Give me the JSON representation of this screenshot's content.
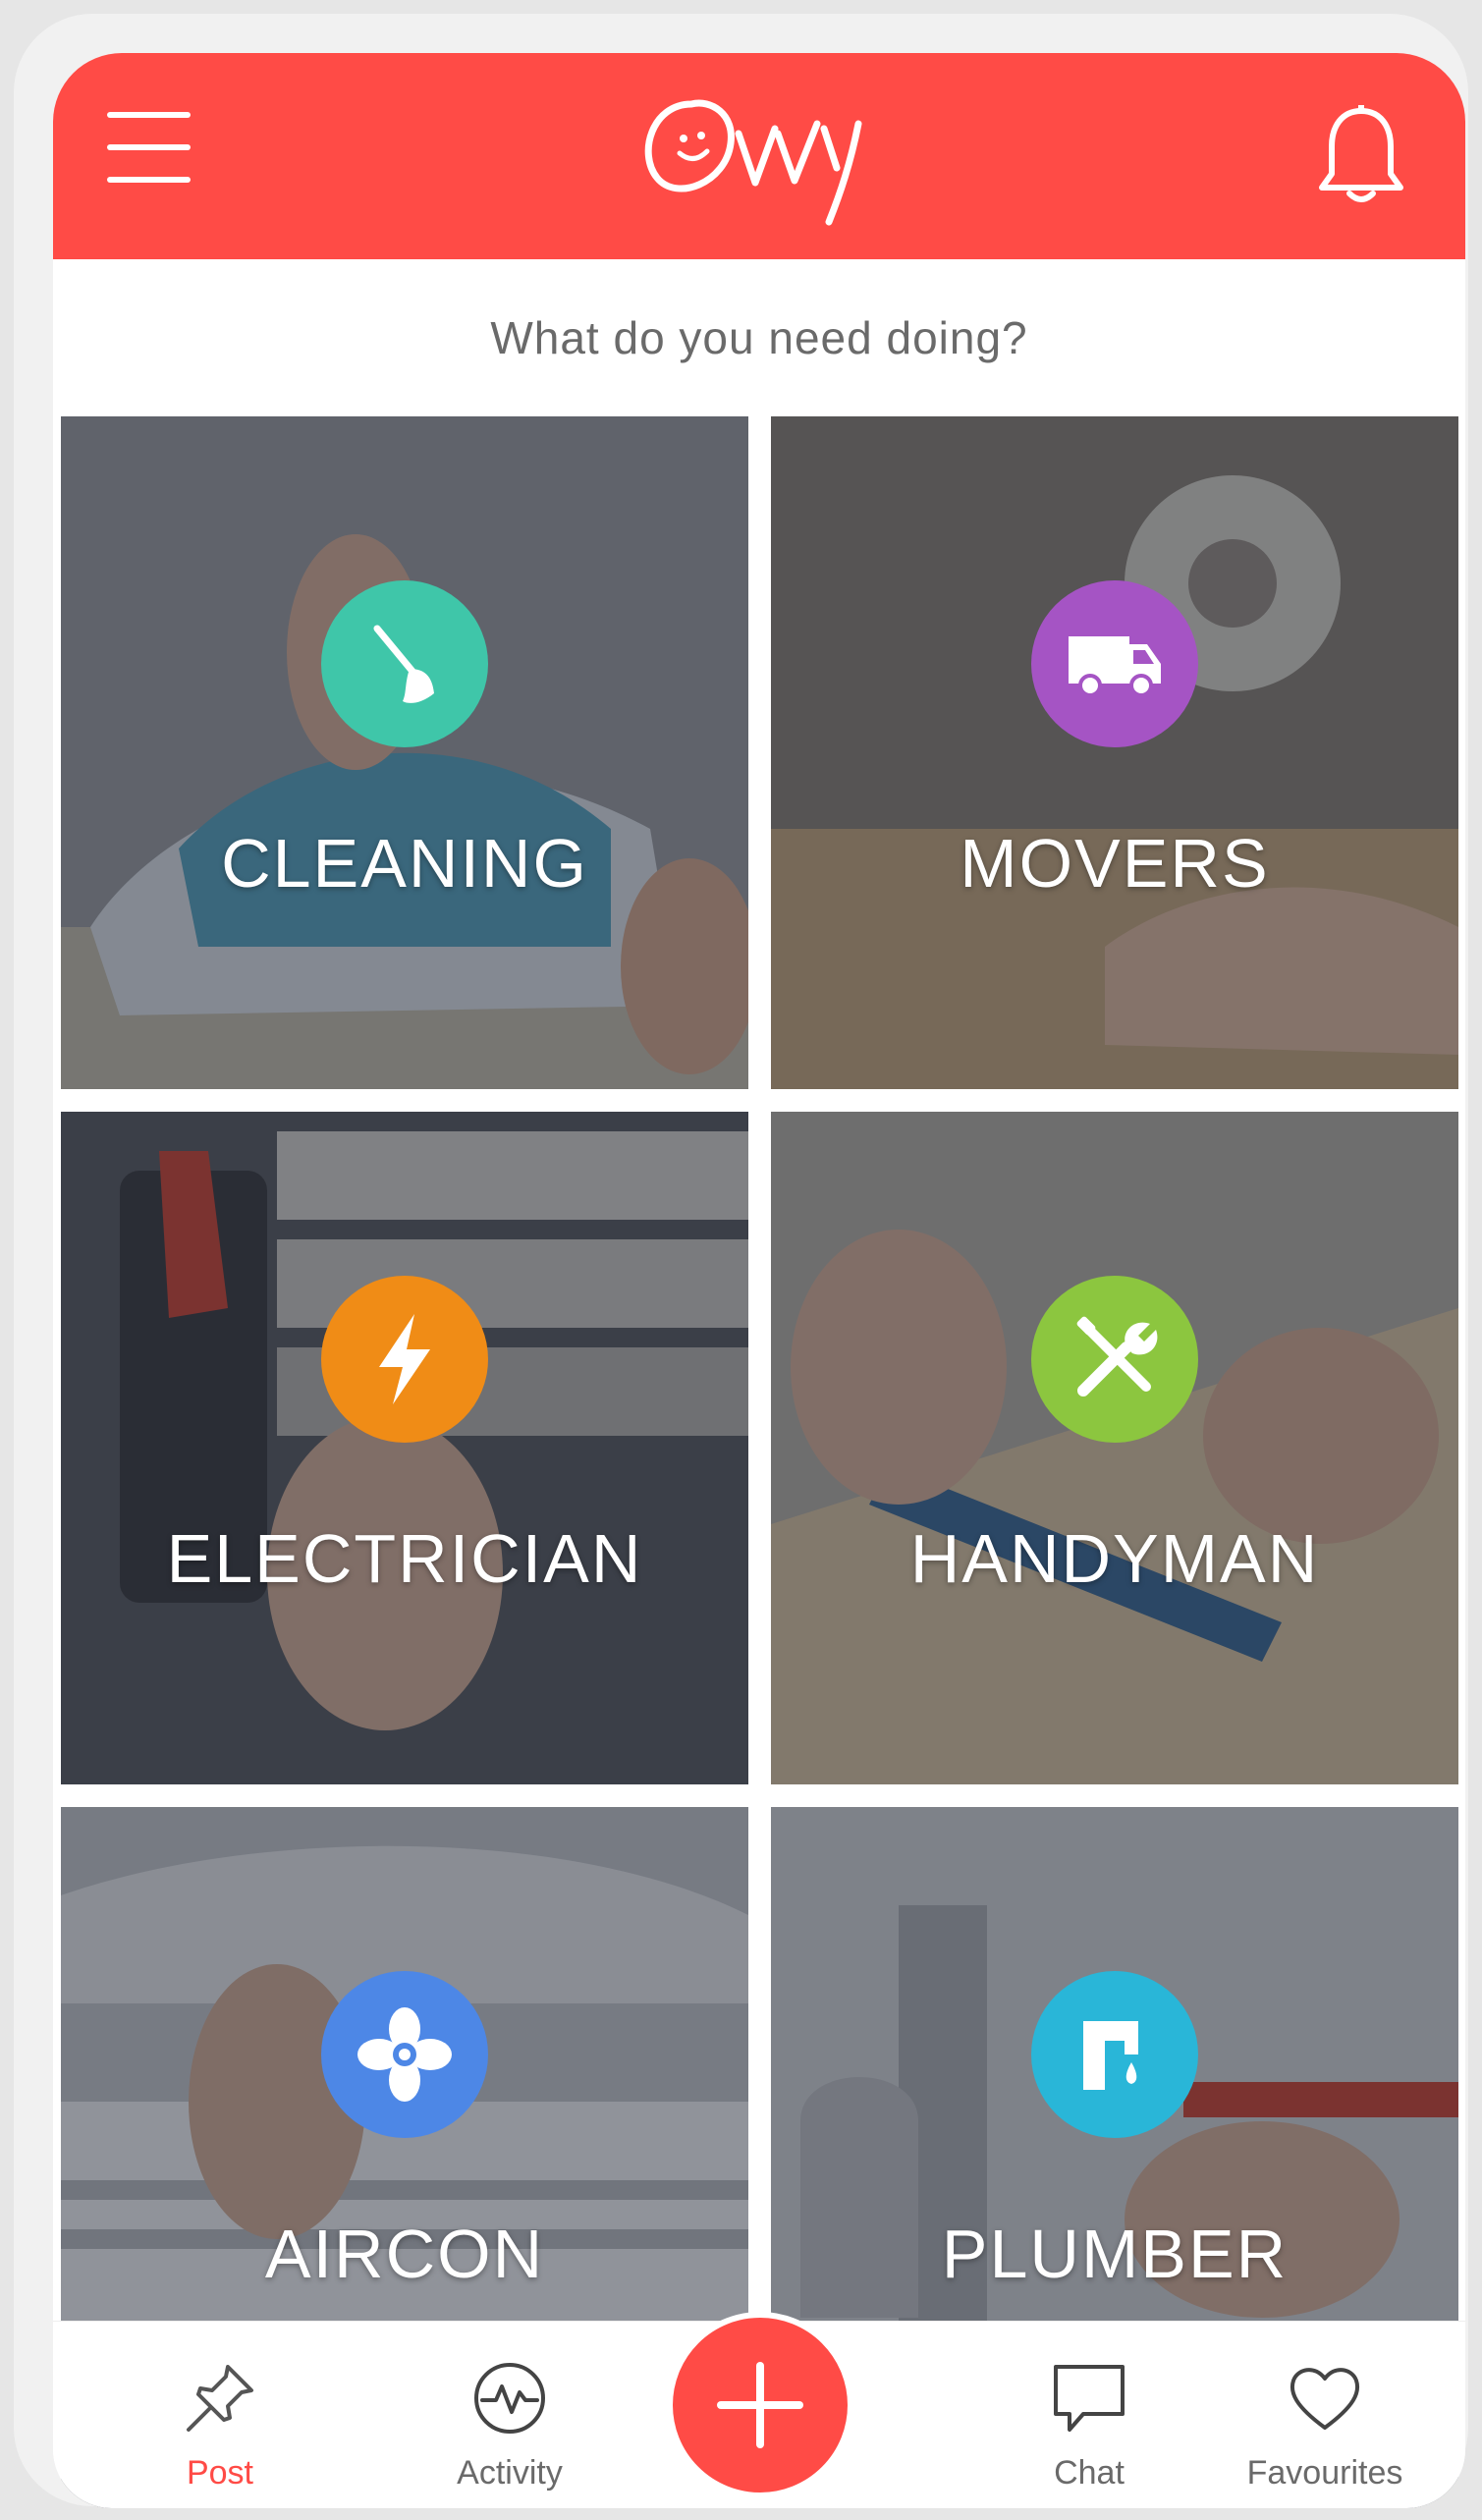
{
  "header": {
    "logo_text": "Ovvy"
  },
  "main": {
    "question": "What do you need doing?"
  },
  "categories": [
    {
      "label": "CLEANING",
      "icon": "broom-icon",
      "color": "#3fc6a9"
    },
    {
      "label": "MOVERS",
      "icon": "van-icon",
      "color": "#a554c4"
    },
    {
      "label": "ELECTRICIAN",
      "icon": "lightning-icon",
      "color": "#f08c16"
    },
    {
      "label": "HANDYMAN",
      "icon": "tools-icon",
      "color": "#8cc63f"
    },
    {
      "label": "AIRCON",
      "icon": "fan-icon",
      "color": "#4d87e6"
    },
    {
      "label": "PLUMBER",
      "icon": "faucet-icon",
      "color": "#29b6d8"
    }
  ],
  "nav": {
    "post": "Post",
    "activity": "Activity",
    "chat": "Chat",
    "favourites": "Favourites"
  },
  "colors": {
    "brand": "#ff4b46",
    "text_muted": "#6a6a6a"
  }
}
